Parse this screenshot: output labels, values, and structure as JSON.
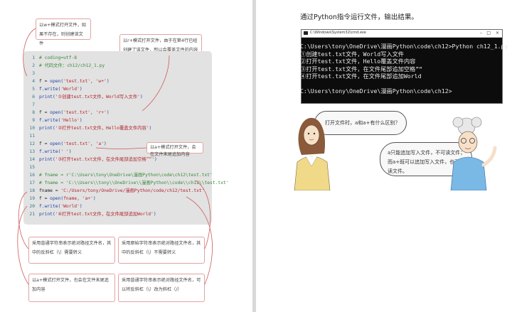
{
  "left_page": {
    "notes": {
      "w_mode": "以w+模式打开文件，如果不存在，则创建该文件",
      "r_mode": "以r+模式打开文件，由于在第4行已经创建了该文件，所以会覆盖文件的内容",
      "a_mode": "以a+模式打开文件，会在文件末尾追加内容",
      "raw_string": "采用原始字符串表示绝对路径文件名，其中的反斜杠（\\）不需要转义",
      "normal_string": "采用普通字符串表示绝对路径文件名，其中的反斜杠（\\）需要转义",
      "a_mode_2": "以a+模式打开文件，也会在文件末尾追加内容",
      "forward_slash": "采用普通字符串表示绝对路径文件名，可以将反斜杠（\\）改为斜杠（/）"
    },
    "code": [
      {
        "n": "1",
        "segments": [
          {
            "t": "# coding=utf-8",
            "c": "c-comment"
          }
        ]
      },
      {
        "n": "2",
        "segments": [
          {
            "t": "# 代码文件：ch12/ch12_1.py",
            "c": "c-comment"
          }
        ]
      },
      {
        "n": "3",
        "segments": []
      },
      {
        "n": "4",
        "segments": [
          {
            "t": "f = ",
            "c": "c-black"
          },
          {
            "t": "open(",
            "c": "c-blue"
          },
          {
            "t": "'test.txt', 'w+'",
            "c": "c-red"
          },
          {
            "t": ")",
            "c": "c-blue"
          }
        ]
      },
      {
        "n": "5",
        "segments": [
          {
            "t": "f.write(",
            "c": "c-blue"
          },
          {
            "t": "'World'",
            "c": "c-red"
          },
          {
            "t": ")",
            "c": "c-blue"
          }
        ]
      },
      {
        "n": "6",
        "segments": [
          {
            "t": "print(",
            "c": "c-blue"
          },
          {
            "t": "'①创建test.txt文件，World写入文件'",
            "c": "c-red"
          },
          {
            "t": ")",
            "c": "c-blue"
          }
        ]
      },
      {
        "n": "7",
        "segments": []
      },
      {
        "n": "8",
        "segments": [
          {
            "t": "f = ",
            "c": "c-black"
          },
          {
            "t": "open(",
            "c": "c-blue"
          },
          {
            "t": "'test.txt', 'r+'",
            "c": "c-red"
          },
          {
            "t": ")",
            "c": "c-blue"
          }
        ]
      },
      {
        "n": "9",
        "segments": [
          {
            "t": "f.write(",
            "c": "c-blue"
          },
          {
            "t": "'Hello'",
            "c": "c-red"
          },
          {
            "t": ")",
            "c": "c-blue"
          }
        ]
      },
      {
        "n": "10",
        "segments": [
          {
            "t": "print(",
            "c": "c-blue"
          },
          {
            "t": "'②打开test.txt文件，Hello覆盖文件内容'",
            "c": "c-red"
          },
          {
            "t": ")",
            "c": "c-blue"
          }
        ]
      },
      {
        "n": "11",
        "segments": []
      },
      {
        "n": "12",
        "segments": [
          {
            "t": "f = ",
            "c": "c-black"
          },
          {
            "t": "open(",
            "c": "c-blue"
          },
          {
            "t": "'test.txt', 'a'",
            "c": "c-red"
          },
          {
            "t": ")",
            "c": "c-blue"
          }
        ]
      },
      {
        "n": "13",
        "segments": [
          {
            "t": "f.write(",
            "c": "c-blue"
          },
          {
            "t": "' '",
            "c": "c-red"
          },
          {
            "t": ")",
            "c": "c-blue"
          }
        ]
      },
      {
        "n": "14",
        "segments": [
          {
            "t": "print(",
            "c": "c-blue"
          },
          {
            "t": "'③打开test.txt文件，在文件尾部追加空格”“'",
            "c": "c-red"
          },
          {
            "t": ")",
            "c": "c-blue"
          }
        ]
      },
      {
        "n": "15",
        "segments": []
      },
      {
        "n": "16",
        "segments": [
          {
            "t": "# fname = r'C:\\Users\\tony\\OneDrive\\漫画Python\\code\\ch12\\test.txt'",
            "c": "c-comment"
          }
        ]
      },
      {
        "n": "17",
        "segments": [
          {
            "t": "# fname = 'C:\\\\Users\\\\tony\\\\OneDrive\\\\漫画Python\\\\code\\\\ch12\\\\test.txt'",
            "c": "c-comment"
          }
        ]
      },
      {
        "n": "18",
        "segments": [
          {
            "t": "fname = ",
            "c": "c-black"
          },
          {
            "t": "'C:/Users/tony/OneDrive/漫画Python/code/ch12/test.txt'",
            "c": "c-red"
          }
        ]
      },
      {
        "n": "19",
        "segments": [
          {
            "t": "f = ",
            "c": "c-black"
          },
          {
            "t": "open(",
            "c": "c-blue"
          },
          {
            "t": "fname, 'a+'",
            "c": "c-red"
          },
          {
            "t": ")",
            "c": "c-blue"
          }
        ]
      },
      {
        "n": "20",
        "segments": [
          {
            "t": "f.write(",
            "c": "c-blue"
          },
          {
            "t": "'World'",
            "c": "c-red"
          },
          {
            "t": ")",
            "c": "c-blue"
          }
        ]
      },
      {
        "n": "21",
        "segments": [
          {
            "t": "print(",
            "c": "c-blue"
          },
          {
            "t": "'④打开test.txt文件，在文件尾部追加World'",
            "c": "c-red"
          },
          {
            "t": ")",
            "c": "c-blue"
          }
        ]
      }
    ]
  },
  "right_page": {
    "intro": "通过Python指令运行文件，输出结果。",
    "console": {
      "title": "C:\\Windows\\System32\\cmd.exe",
      "lines": [
        "C:\\Users\\tony\\OneDrive\\漫画Python\\code\\ch12>Python ch12_1.py",
        "①创建test.txt文件，World写入文件",
        "②打开test.txt文件，Hello覆盖文件内容",
        "③打开test.txt文件，在文件尾部追加空格”“",
        "④打开test.txt文件，在文件尾部追加World",
        "",
        "C:\\Users\\tony\\OneDrive\\漫画Python\\code\\ch12>"
      ]
    },
    "question": "打开文件时，a和a+有什么区别？",
    "answer": "a只能追加写入文件，不可读文件；而a+既可以追加写入文件，也可以读文件。"
  }
}
